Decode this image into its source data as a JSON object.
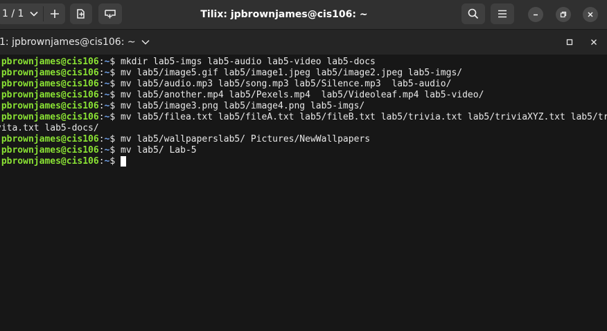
{
  "window": {
    "title": "Tilix: jpbrownjames@cis106: ~"
  },
  "headerbar": {
    "session_label": "1 / 1",
    "icons": {
      "session_caret": "chevron-down-icon",
      "add_session": "plus-icon",
      "add_terminal_right": "split-right-icon",
      "add_terminal_down": "split-down-icon",
      "search": "search-icon",
      "menu": "hamburger-menu-icon",
      "minimize": "minimize-icon",
      "maximize": "restore-icon",
      "close": "close-icon"
    }
  },
  "terminal_titlebar": {
    "title": "1: jpbrownjames@cis106: ~",
    "icons": {
      "caret": "chevron-down-icon",
      "maximize": "maximize-square-icon",
      "close": "close-icon"
    }
  },
  "terminal": {
    "prompt": {
      "user_host": "jpbrownjames@cis106",
      "separator": ":",
      "path": "~",
      "symbol": "$"
    },
    "colors": {
      "user_host": "#8ae234",
      "path": "#6fa0e8",
      "text": "#e8e8e8",
      "background": "#171717"
    },
    "lines": [
      {
        "type": "prompt",
        "command": " mkdir lab5-imgs lab5-audio lab5-video lab5-docs"
      },
      {
        "type": "prompt",
        "command": " mv lab5/image5.gif lab5/image1.jpeg lab5/image2.jpeg lab5-imgs/"
      },
      {
        "type": "prompt",
        "command": " mv lab5/audio.mp3 lab5/song.mp3 lab5/Silence.mp3  lab5-audio/"
      },
      {
        "type": "prompt",
        "command": " mv lab5/another.mp4 lab5/Pexels.mp4  lab5/Videoleaf.mp4 lab5-video/"
      },
      {
        "type": "prompt",
        "command": " mv lab5/image3.png lab5/image4.png lab5-imgs/"
      },
      {
        "type": "prompt",
        "command": " mv lab5/filea.txt lab5/fileA.txt lab5/fileB.txt lab5/trivia.txt lab5/triviaXYZ.txt lab5/tri"
      },
      {
        "type": "output",
        "text": "vita.txt lab5-docs/"
      },
      {
        "type": "prompt",
        "command": " mv lab5/wallpaperslab5/ Pictures/NewWallpapers"
      },
      {
        "type": "prompt",
        "command": " mv lab5/ Lab-5"
      },
      {
        "type": "prompt",
        "command": " ",
        "cursor": true
      }
    ]
  }
}
